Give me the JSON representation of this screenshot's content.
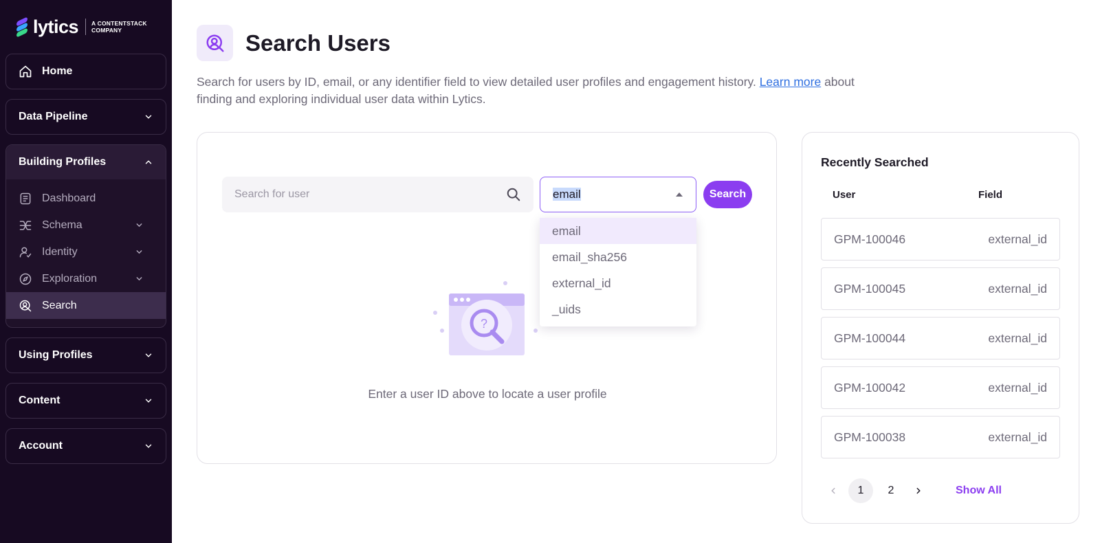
{
  "brand": {
    "name": "lytics",
    "tagline_line1": "A CONTENTSTACK",
    "tagline_line2": "COMPANY"
  },
  "sidebar": {
    "home": "Home",
    "sections": [
      {
        "label": "Data Pipeline"
      },
      {
        "label": "Building Profiles",
        "items": [
          {
            "label": "Dashboard"
          },
          {
            "label": "Schema"
          },
          {
            "label": "Identity"
          },
          {
            "label": "Exploration"
          },
          {
            "label": "Search"
          }
        ]
      },
      {
        "label": "Using Profiles"
      },
      {
        "label": "Content"
      },
      {
        "label": "Account"
      }
    ],
    "active_item": "Search"
  },
  "page": {
    "title": "Search Users",
    "description_before": "Search for users by ID, email, or any identifier field to view detailed user profiles and engagement history. ",
    "description_link": "Learn more",
    "description_after": " about finding and exploring individual user data within Lytics."
  },
  "search": {
    "placeholder": "Search for user",
    "field_selected": "email",
    "button_label": "Search",
    "field_options": [
      "email",
      "email_sha256",
      "external_id",
      "_uids"
    ],
    "empty_text": "Enter a user ID above to locate a user profile"
  },
  "recent": {
    "title": "Recently Searched",
    "col_user": "User",
    "col_field": "Field",
    "rows": [
      {
        "user": "GPM-100046",
        "field": "external_id"
      },
      {
        "user": "GPM-100045",
        "field": "external_id"
      },
      {
        "user": "GPM-100044",
        "field": "external_id"
      },
      {
        "user": "GPM-100042",
        "field": "external_id"
      },
      {
        "user": "GPM-100038",
        "field": "external_id"
      }
    ],
    "pages": [
      "1",
      "2"
    ],
    "current_page": "1",
    "show_all": "Show All"
  },
  "colors": {
    "accent": "#8b3df0",
    "sidebar_bg": "#170a22",
    "link": "#2f6fe0"
  }
}
